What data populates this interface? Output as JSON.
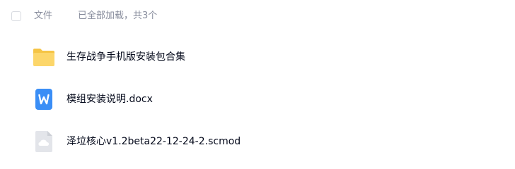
{
  "header": {
    "column_label": "文件",
    "load_status": "已全部加载，共3个"
  },
  "files": [
    {
      "name": "生存战争手机版安装包合集",
      "icon": "folder-icon"
    },
    {
      "name": "模组安装说明.docx",
      "icon": "word-doc-icon"
    },
    {
      "name": "泽垃核心v1.2beta22-12-24-2.scmod",
      "icon": "unknown-file-cloud-icon"
    }
  ],
  "colors": {
    "folder": "#fcd66a",
    "word_doc": "#3a8ef6",
    "generic_file": "#e3e5ea",
    "muted_text": "#878c9c",
    "primary_text": "#03081a"
  }
}
